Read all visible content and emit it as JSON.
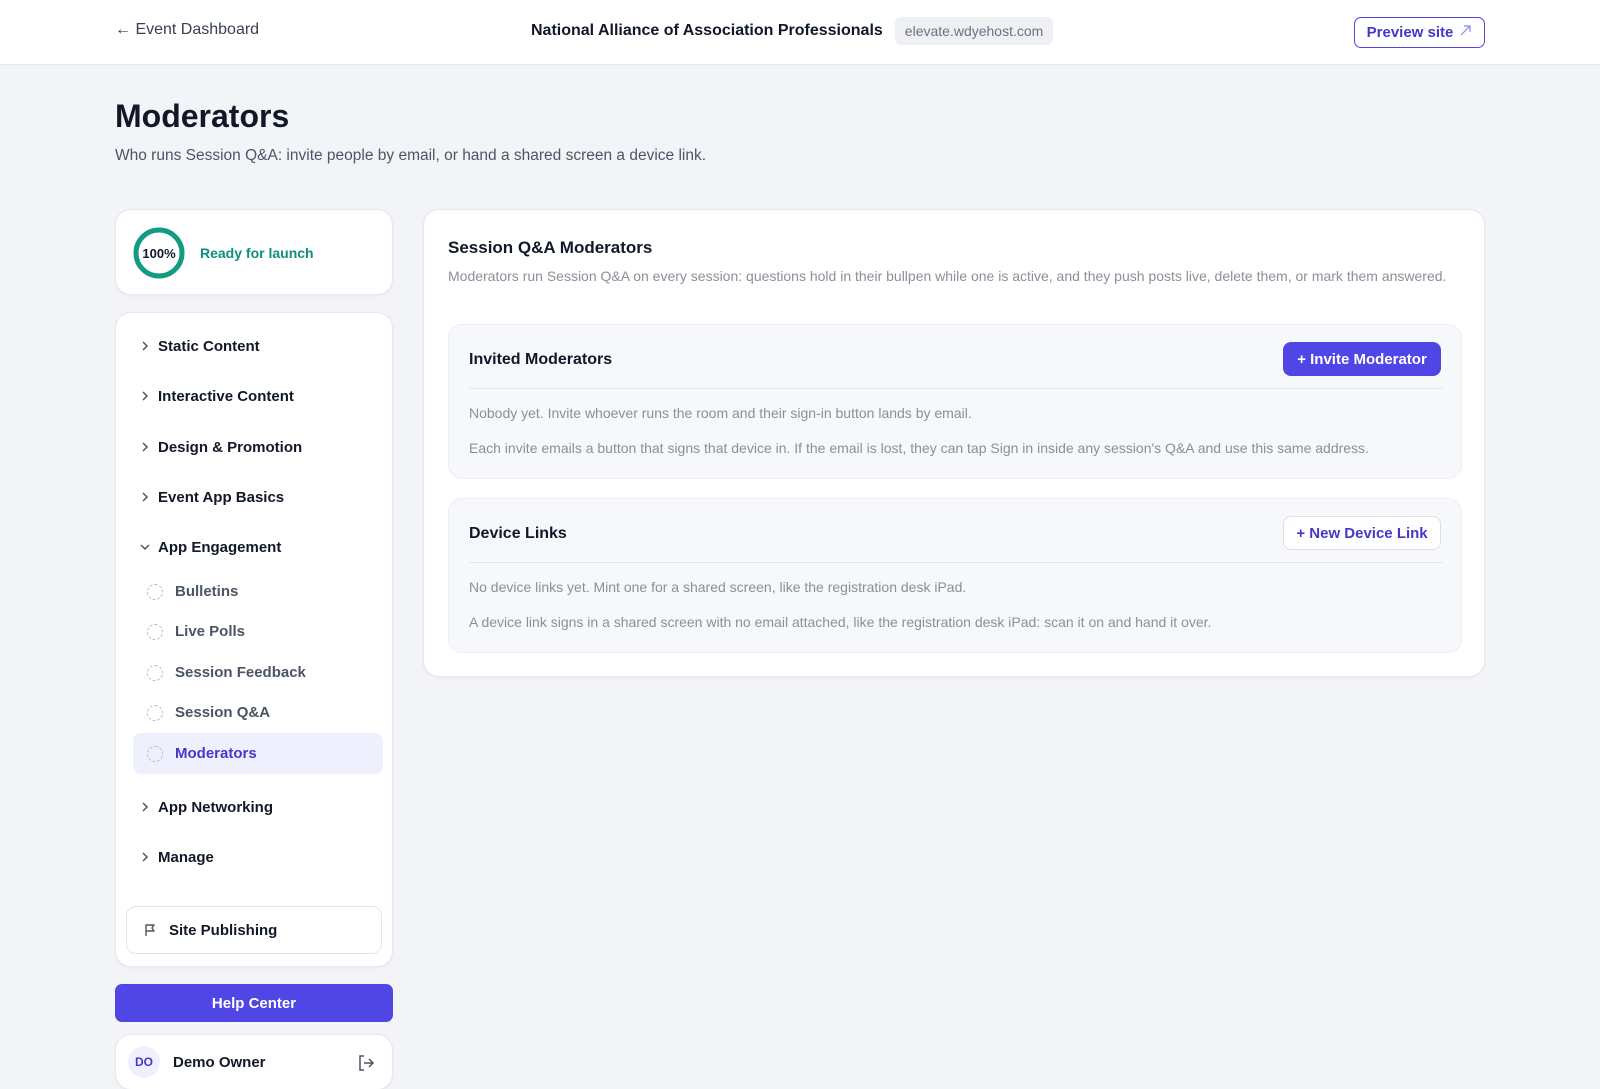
{
  "header": {
    "back_label": "← Event Dashboard",
    "org_name": "National Alliance of Association Professionals",
    "domain": "elevate.wdyehost.com",
    "preview_label": "Preview site"
  },
  "page": {
    "title": "Moderators",
    "subtitle": "Who runs Session Q&A: invite people by email, or hand a shared screen a device link."
  },
  "launch": {
    "percent_label": "100%",
    "progress": 1.0,
    "status": "Ready for launch",
    "accent": "#0f8f7a"
  },
  "sidebar": {
    "groups": [
      {
        "label": "Static Content",
        "expanded": false
      },
      {
        "label": "Interactive Content",
        "expanded": false
      },
      {
        "label": "Design & Promotion",
        "expanded": false
      },
      {
        "label": "Event App Basics",
        "expanded": false
      },
      {
        "label": "App Engagement",
        "expanded": true
      },
      {
        "label": "App Networking",
        "expanded": false
      },
      {
        "label": "Manage",
        "expanded": false
      }
    ],
    "engagement_items": [
      {
        "label": "Bulletins",
        "active": false
      },
      {
        "label": "Live Polls",
        "active": false
      },
      {
        "label": "Session Feedback",
        "active": false
      },
      {
        "label": "Session Q&A",
        "active": false
      },
      {
        "label": "Moderators",
        "active": true
      }
    ],
    "publishing_label": "Site Publishing"
  },
  "help_label": "Help Center",
  "user": {
    "initials": "DO",
    "name": "Demo Owner"
  },
  "main": {
    "title": "Session Q&A Moderators",
    "description": "Moderators run Session Q&A on every session: questions hold in their bullpen while one is active, and they push posts live, delete them, or mark them answered.",
    "invited": {
      "title": "Invited Moderators",
      "button": "+ Invite Moderator",
      "empty": "Nobody yet. Invite whoever runs the room and their sign-in button lands by email.",
      "note": "Each invite emails a button that signs that device in. If the email is lost, they can tap Sign in inside any session's Q&A and use this same address."
    },
    "devices": {
      "title": "Device Links",
      "button": "+ New Device Link",
      "empty": "No device links yet. Mint one for a shared screen, like the registration desk iPad.",
      "note": "A device link signs in a shared screen with no email attached, like the registration desk iPad: scan it on and hand it over."
    }
  },
  "colors": {
    "brand": "#4f46e5",
    "brand_text": "#4338ca",
    "success": "#0f8f7a"
  }
}
